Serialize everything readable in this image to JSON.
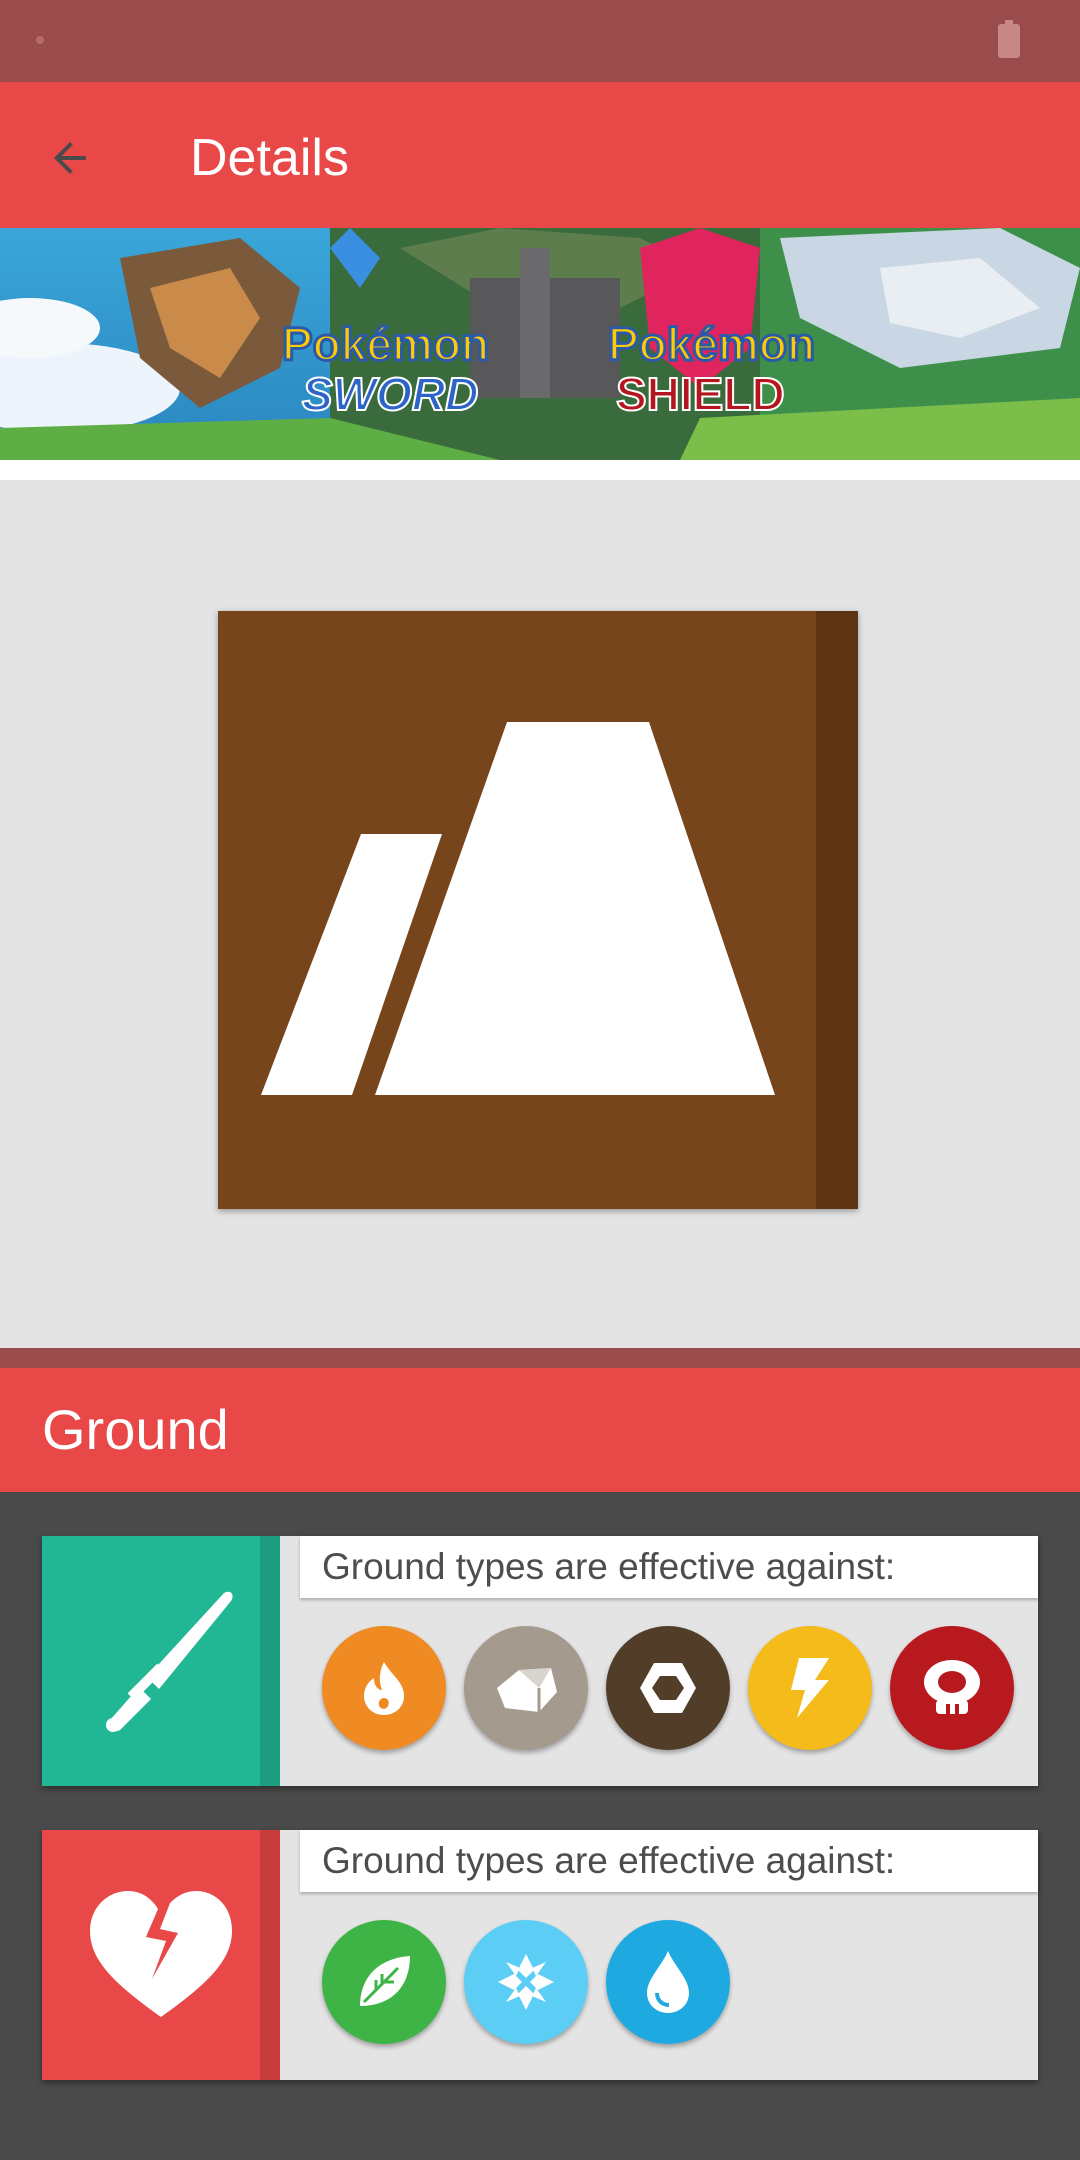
{
  "app_bar": {
    "title": "Details"
  },
  "banner": {
    "left_logo": "Pokémon",
    "left_sub": "SWORD",
    "right_logo": "Pokémon",
    "right_sub": "SHIELD"
  },
  "type": {
    "name": "Ground",
    "color": "#77451b"
  },
  "strong_against": {
    "label": "Ground types are effective against:",
    "icon": "sword-icon",
    "color": "#21b795",
    "types": [
      {
        "icon": "fire-icon",
        "color": "#f08b24"
      },
      {
        "icon": "rock-icon",
        "color": "#a49a8e"
      },
      {
        "icon": "steel-icon",
        "color": "#523e28"
      },
      {
        "icon": "electric-icon",
        "color": "#f4bb1a"
      },
      {
        "icon": "poison-icon",
        "color": "#b8191f"
      }
    ]
  },
  "weak_against": {
    "label": "Ground types are effective against:",
    "icon": "broken-heart-icon",
    "color": "#e84848",
    "types": [
      {
        "icon": "grass-icon",
        "color": "#3fb446"
      },
      {
        "icon": "ice-icon",
        "color": "#5ccef5"
      },
      {
        "icon": "water-icon",
        "color": "#1fa9e1"
      }
    ]
  }
}
